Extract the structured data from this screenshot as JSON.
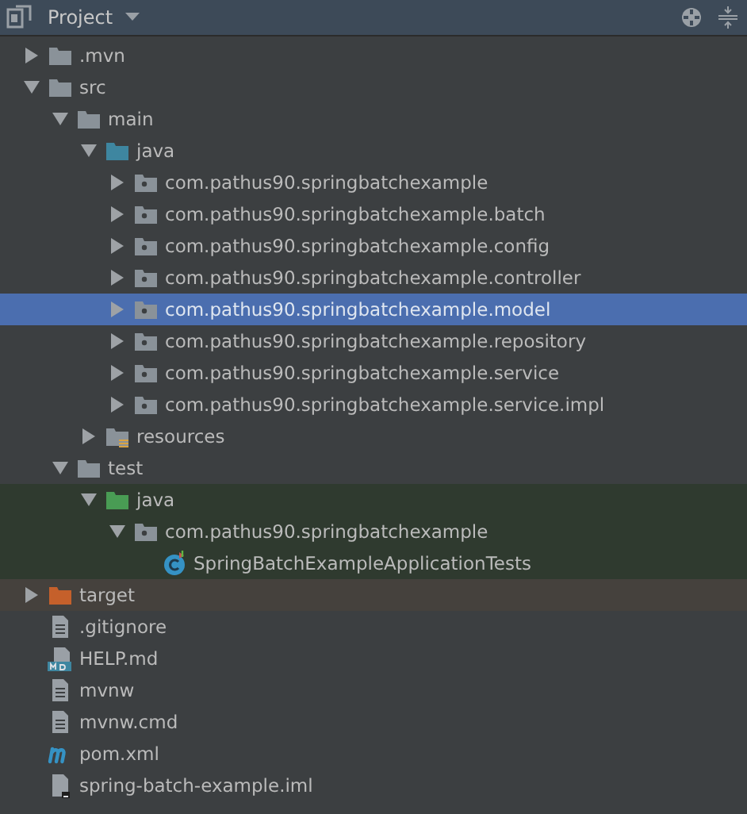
{
  "header": {
    "title": "Project"
  },
  "tree": [
    {
      "label": ".mvn",
      "kind": "folder",
      "expanded": false,
      "selected": false
    },
    {
      "label": "src",
      "kind": "folder",
      "expanded": true,
      "selected": false,
      "children": [
        {
          "label": "main",
          "kind": "folder",
          "expanded": true,
          "selected": false,
          "children": [
            {
              "label": "java",
              "kind": "source-folder",
              "expanded": true,
              "selected": false,
              "children": [
                {
                  "label": "com.pathus90.springbatchexample",
                  "kind": "package",
                  "expanded": false,
                  "selected": false
                },
                {
                  "label": "com.pathus90.springbatchexample.batch",
                  "kind": "package",
                  "expanded": false,
                  "selected": false
                },
                {
                  "label": "com.pathus90.springbatchexample.config",
                  "kind": "package",
                  "expanded": false,
                  "selected": false
                },
                {
                  "label": "com.pathus90.springbatchexample.controller",
                  "kind": "package",
                  "expanded": false,
                  "selected": false
                },
                {
                  "label": "com.pathus90.springbatchexample.model",
                  "kind": "package",
                  "expanded": false,
                  "selected": true
                },
                {
                  "label": "com.pathus90.springbatchexample.repository",
                  "kind": "package",
                  "expanded": false,
                  "selected": false
                },
                {
                  "label": "com.pathus90.springbatchexample.service",
                  "kind": "package",
                  "expanded": false,
                  "selected": false
                },
                {
                  "label": "com.pathus90.springbatchexample.service.impl",
                  "kind": "package",
                  "expanded": false,
                  "selected": false
                }
              ]
            },
            {
              "label": "resources",
              "kind": "resources-folder",
              "expanded": false,
              "selected": false
            }
          ]
        },
        {
          "label": "test",
          "kind": "folder",
          "expanded": true,
          "selected": false,
          "children": [
            {
              "label": "java",
              "kind": "test-folder",
              "expanded": true,
              "selected": false,
              "children": [
                {
                  "label": "com.pathus90.springbatchexample",
                  "kind": "package",
                  "expanded": true,
                  "selected": false,
                  "children": [
                    {
                      "label": "SpringBatchExampleApplicationTests",
                      "kind": "class",
                      "selected": false
                    }
                  ]
                }
              ]
            }
          ]
        }
      ]
    },
    {
      "label": "target",
      "kind": "excluded-folder",
      "expanded": false,
      "selected": false
    },
    {
      "label": ".gitignore",
      "kind": "file",
      "selected": false
    },
    {
      "label": "HELP.md",
      "kind": "markdown",
      "selected": false
    },
    {
      "label": "mvnw",
      "kind": "file",
      "selected": false
    },
    {
      "label": "mvnw.cmd",
      "kind": "file",
      "selected": false
    },
    {
      "label": "pom.xml",
      "kind": "maven",
      "selected": false
    },
    {
      "label": "spring-batch-example.iml",
      "kind": "module-file",
      "selected": false
    }
  ]
}
